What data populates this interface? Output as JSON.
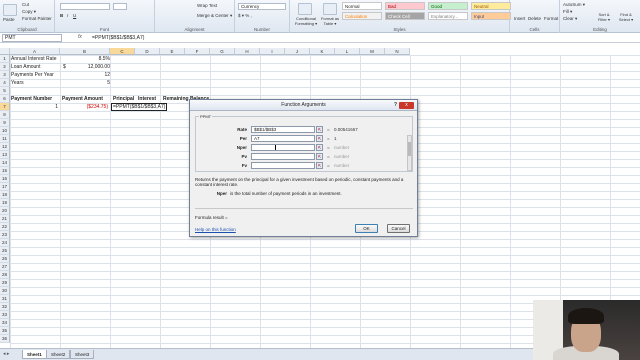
{
  "ribbon": {
    "clipboard": {
      "cut": "Cut",
      "copy": "Copy ▾",
      "format_painter": "Format Painter",
      "paste": "Paste",
      "label": "Clipboard"
    },
    "font": {
      "label": "Font"
    },
    "alignment": {
      "wrap_text": "Wrap Text",
      "merge_center": "Merge & Center ▾",
      "label": "Alignment"
    },
    "number": {
      "format": "Currency",
      "label": "Number"
    },
    "styles": {
      "conditional_formatting": "Conditional Formatting ▾",
      "format_as_table": "Format as Table ▾",
      "cells": [
        {
          "name": "Normal",
          "bg": "#ffffff",
          "color": "#222222"
        },
        {
          "name": "Bad",
          "bg": "#ffc7ce",
          "color": "#9c0006"
        },
        {
          "name": "Good",
          "bg": "#c6efce",
          "color": "#006100"
        },
        {
          "name": "Neutral",
          "bg": "#ffeb9c",
          "color": "#9c5700"
        },
        {
          "name": "Calculation",
          "bg": "#f2f2f2",
          "color": "#fa7d00"
        },
        {
          "name": "Check Cell",
          "bg": "#a5a5a5",
          "color": "#ffffff"
        },
        {
          "name": "Explanatory...",
          "bg": "#ffffff",
          "color": "#7f7f7f"
        },
        {
          "name": "Input",
          "bg": "#ffcc99",
          "color": "#3f3f76"
        }
      ],
      "label": "Styles"
    },
    "cells": {
      "insert": "Insert",
      "delete": "Delete",
      "format": "Format",
      "label": "Cells"
    },
    "editing": {
      "autosum": "AutoSum ▾",
      "fill": "Fill ▾",
      "clear": "Clear ▾",
      "sort_filter": "Sort & Filter ▾",
      "find_select": "Find & Select ▾",
      "label": "Editing"
    }
  },
  "formula_bar": {
    "name_box": "PMT",
    "fx": "fx",
    "formula": "=PPMT($B$1/$B$3,A7)"
  },
  "columns": [
    "A",
    "B",
    "C",
    "D",
    "E",
    "F",
    "G",
    "H",
    "I",
    "J",
    "K",
    "L",
    "M",
    "N"
  ],
  "rows": [
    "1",
    "2",
    "3",
    "4",
    "5",
    "6",
    "7",
    "8",
    "9",
    "10",
    "11",
    "12",
    "13",
    "14",
    "15",
    "16",
    "17",
    "18",
    "19",
    "20",
    "21",
    "22",
    "23",
    "24",
    "25",
    "26",
    "27",
    "28",
    "29",
    "30",
    "31",
    "32",
    "33",
    "34",
    "35",
    "36"
  ],
  "cells": {
    "a1": "Annual Interest Rate",
    "b1": "8.5%",
    "a2": "Loan Amount",
    "b2_sym": "$",
    "b2": "12,000.00",
    "a3": "Payments Per Year",
    "b3": "12",
    "a4": "Years",
    "b4": "5",
    "a6": "Payment Number",
    "b6": "Payment Amount",
    "c6": "Principal",
    "d6": "Interest",
    "e6": "Remaining Balance",
    "a7": "1",
    "b7": "($234.75)",
    "c7": "=PPMT($B$1/$B$3,A7)"
  },
  "dialog": {
    "title": "Function Arguments",
    "help": "?",
    "close": "x",
    "function_name": "PPMT",
    "args": [
      {
        "label": "Rate",
        "value": "$B$1/$B$3",
        "result": "0.00541667"
      },
      {
        "label": "Per",
        "value": "A7",
        "result": "1"
      },
      {
        "label": "Nper",
        "value": "",
        "result": "number"
      },
      {
        "label": "Pv",
        "value": "",
        "result": "number"
      },
      {
        "label": "Fv",
        "value": "",
        "result": "number"
      }
    ],
    "equals": "=",
    "description": "Returns the payment on the principal for a given investment based on periodic, constant payments and a constant interest rate.",
    "arg_help_name": "Nper",
    "arg_help_text": "is the total number of payment periods in an investment.",
    "formula_result": "Formula result =",
    "help_link": "Help on this function",
    "ok": "OK",
    "cancel": "Cancel"
  },
  "sheets": [
    "Sheet1",
    "Sheet2",
    "Sheet3"
  ]
}
